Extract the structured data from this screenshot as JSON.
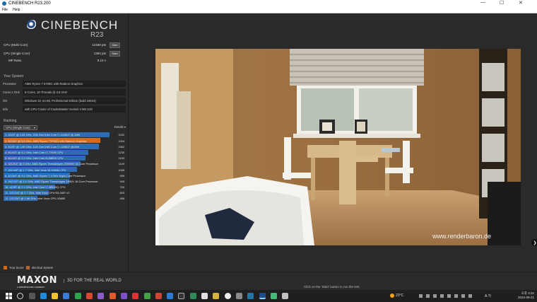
{
  "window": {
    "title": "CINEBENCH R23.200",
    "min": "—",
    "max": "☐",
    "close": "✕"
  },
  "menu": [
    "File",
    "Help"
  ],
  "logo": {
    "word": "CINEBENCH",
    "version": "R23"
  },
  "scores": [
    {
      "label": "CPU (Multi Core)",
      "value": "12489 pts",
      "button": "Start"
    },
    {
      "label": "CPU (Single Core)",
      "value": "1394 pts",
      "button": "Start"
    },
    {
      "label": "MP Ratio",
      "value": "9.10 x",
      "button": ""
    }
  ],
  "system": {
    "heading": "Your System",
    "rows": [
      {
        "k": "Processor",
        "v": "AMD Ryzen 7 5700G with Radeon Graphics"
      },
      {
        "k": "Cores x GHz",
        "v": "8 Cores, 16 Threads @ 3.8 GHz"
      },
      {
        "k": "OS",
        "v": "Windows 10, 64 Bit, Professional Edition (build 19044)"
      },
      {
        "k": "Info",
        "v": "with CPU Cooler of CoolerMaster Gemini II M5 LED"
      }
    ]
  },
  "ranking": {
    "heading": "Ranking",
    "select": "CPU (Single Core)",
    "details": "Details",
    "rows": [
      {
        "label": "1. 4C/8T @ 2.81 GHz, 11th Gen Intel Core i7-1165G7 @ 28W",
        "score": 1532,
        "me": false
      },
      {
        "label": "2. 8C/16T @ 3.8 GHz, AMD Ryzen 7 5700G with Radeon Graphics",
        "score": 1394,
        "me": true
      },
      {
        "label": "3. 4C/8T @ 1.69 GHz, 11th Gen Intel Core i7-1165G7 @15W",
        "score": 1382,
        "me": false
      },
      {
        "label": "4. 8C/16T @ 4.2 GHz, Intel Core i7-7700K CPU",
        "score": 1230,
        "me": false
      },
      {
        "label": "5. 8C/16T @ 2.3 GHz, Intel Core i9-9880H CPU",
        "score": 1183,
        "me": false
      },
      {
        "label": "6. 32C/64T @ 3 GHz, AMD Ryzen Threadripper 2990WX 32-Core Processor",
        "score": 1109,
        "me": false
      },
      {
        "label": "7. 24C/48T @ 2.7 GHz, Intel Xeon W-3265M CPU",
        "score": 1058,
        "me": false
      },
      {
        "label": "8. 8C/16T @ 3.4 GHz, AMD Ryzen 7 1700X Eight-Core Processor",
        "score": 959,
        "me": false
      },
      {
        "label": "9. 16C/32T @ 3.4 GHz, AMD Ryzen Threadripper 1950X 16-Core Processor",
        "score": 945,
        "me": false
      },
      {
        "label": "10. 4C/8T @ 2.3 GHz, Intel Core i7-4850HQ CPU",
        "score": 750,
        "me": false
      },
      {
        "label": "11. 12C/24T @ 2.7 GHz, Intel Xeon CPU E5-2697 v2",
        "score": 653,
        "me": false
      },
      {
        "label": "12. 12C/24T @ 2.66 GHz, Intel Xeon CPU X5650",
        "score": 486,
        "me": false
      }
    ]
  },
  "legend": {
    "your_score": "Your Score",
    "identical": "Identical System",
    "your_color": "#d76a1a",
    "identical_color": "#b0683a"
  },
  "footer": {
    "brand": "MAXON",
    "brand_sub": "A NEMETSCHEK COMPANY",
    "slogan": "3D FOR THE REAL WORLD",
    "hint": "Click on the 'Start' button to run the test."
  },
  "render": {
    "watermark": "www.renderbaron.de"
  },
  "taskbar": {
    "temp": "23°C",
    "lang": "A",
    "ime": "가",
    "clock_line1": "오후 3:32",
    "clock_line2": "2022-09-21"
  }
}
